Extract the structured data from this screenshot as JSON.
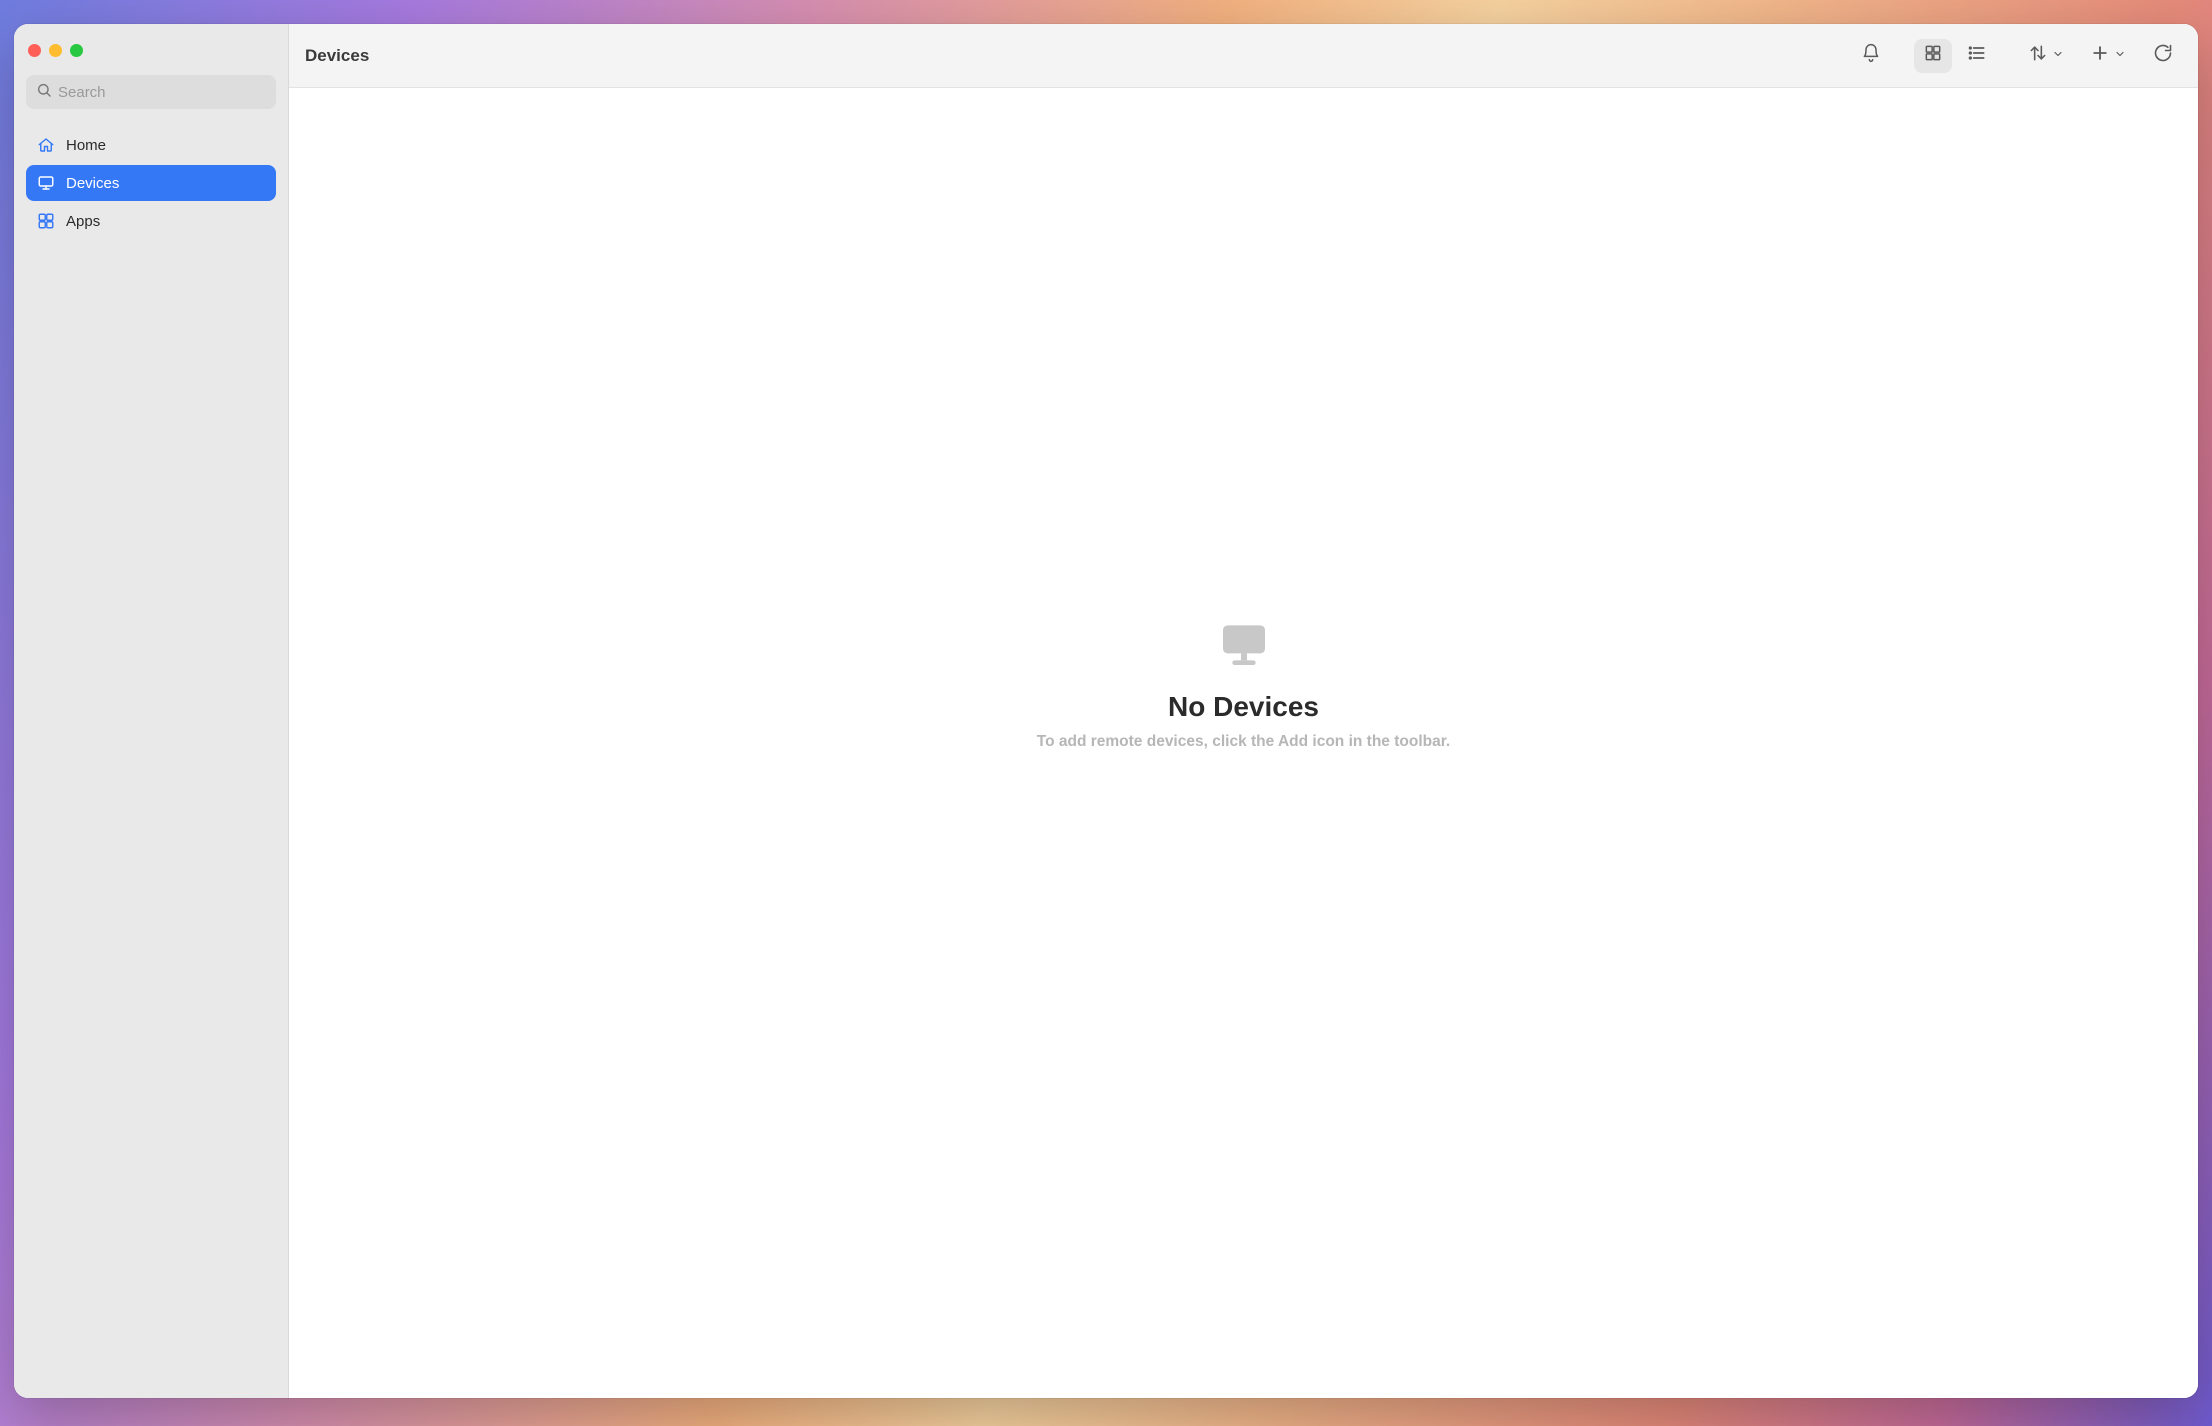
{
  "header": {
    "title": "Devices"
  },
  "search": {
    "placeholder": "Search",
    "value": ""
  },
  "sidebar": {
    "items": [
      {
        "id": "home",
        "label": "Home",
        "icon": "house-icon",
        "active": false
      },
      {
        "id": "devices",
        "label": "Devices",
        "icon": "display-icon",
        "active": true
      },
      {
        "id": "apps",
        "label": "Apps",
        "icon": "apps-icon",
        "active": false
      }
    ]
  },
  "toolbar": {
    "notifications_name": "notifications-button",
    "view_grid_name": "grid-view-button",
    "view_list_name": "list-view-button",
    "sort_name": "sort-button",
    "add_name": "add-button",
    "refresh_name": "refresh-button",
    "selected_view": "grid"
  },
  "empty_state": {
    "title": "No Devices",
    "subtitle": "To add remote devices, click the Add icon in the toolbar."
  },
  "colors": {
    "accent": "#3478f6",
    "sidebar_bg": "#e9e9ea",
    "toolbar_bg": "#f4f4f5"
  }
}
